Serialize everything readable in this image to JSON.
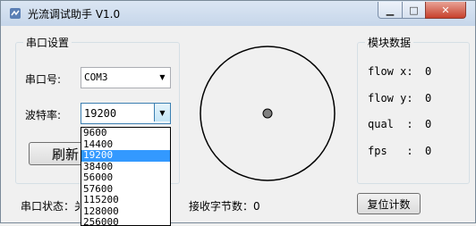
{
  "window": {
    "title": "光流调试助手 V1.0"
  },
  "serial": {
    "group_title": "串口设置",
    "port_label": "串口号:",
    "port_value": "COM3",
    "baud_label": "波特率:",
    "baud_value": "19200",
    "baud_options": [
      "9600",
      "14400",
      "19200",
      "38400",
      "56000",
      "57600",
      "115200",
      "128000",
      "256000"
    ],
    "refresh_label": "刷新",
    "status_label": "串口状态：关"
  },
  "module": {
    "group_title": "模块数据",
    "flow_x_label": "flow x:",
    "flow_x_value": "0",
    "flow_y_label": "flow y:",
    "flow_y_value": "0",
    "qual_label": "qual  :",
    "qual_value": "0",
    "fps_label": "fps   :",
    "fps_value": "0"
  },
  "bytes_label": "接收字节数：0",
  "reset_button": "复位计数"
}
